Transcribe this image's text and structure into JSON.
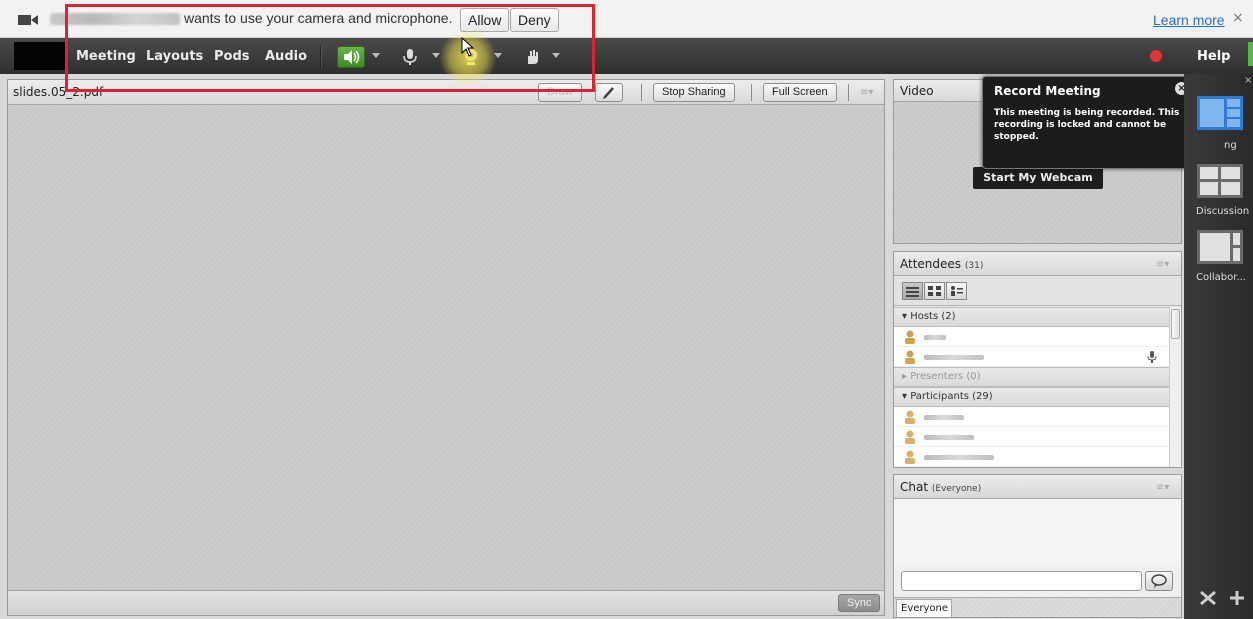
{
  "permission_bar": {
    "message": "wants to use your camera and microphone.",
    "allow_label": "Allow",
    "deny_label": "Deny",
    "learn_more_label": "Learn more",
    "close_symbol": "×"
  },
  "menubar": {
    "items": [
      "Meeting",
      "Layouts",
      "Pods",
      "Audio"
    ],
    "help_label": "Help",
    "icons": [
      "speaker-icon",
      "microphone-icon",
      "webcam-icon",
      "raise-hand-icon"
    ],
    "record_color": "#e3342f",
    "speaker_active_color": "#4aa02c"
  },
  "share_pod": {
    "title": "slides.05_2.pdf",
    "draw_label": "Draw",
    "stop_sharing_label": "Stop Sharing",
    "full_screen_label": "Full Screen",
    "sync_label": "Sync"
  },
  "video_pod": {
    "title": "Video",
    "start_webcam_label": "Start My Webcam"
  },
  "record_tooltip": {
    "title": "Record Meeting",
    "text": "This meeting is being recorded. This recording is locked and cannot be stopped."
  },
  "attendees_pod": {
    "title": "Attendees",
    "count": "(31)",
    "groups": {
      "hosts": "Hosts (2)",
      "presenters": "Presenters (0)",
      "participants": "Participants (29)"
    }
  },
  "chat_pod": {
    "title": "Chat",
    "scope": "(Everyone)",
    "tab_label": "Everyone"
  },
  "layout_rail": {
    "labels": [
      "ng",
      "Discussion",
      "Collabor..."
    ],
    "rail_close": "×"
  }
}
